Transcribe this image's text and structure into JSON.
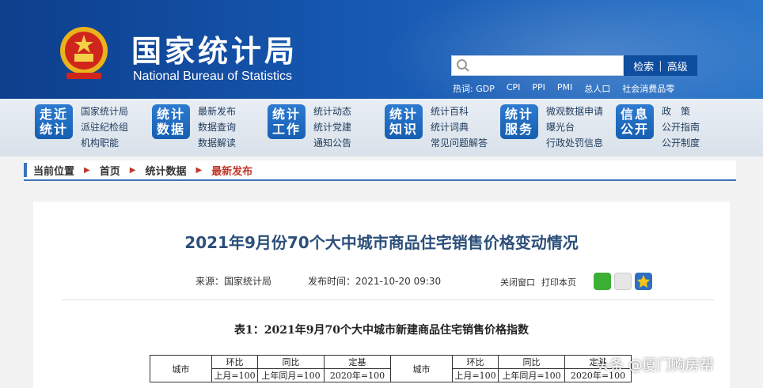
{
  "header": {
    "title": "国家统计局",
    "subtitle": "National Bureau of Statistics",
    "search_button": "检索",
    "search_separator": "|",
    "advanced_button": "高级",
    "hotwords": [
      "热词: GDP",
      "CPI",
      "PPI",
      "PMI",
      "总人口",
      "社会消费品零"
    ]
  },
  "nav": [
    {
      "badge_line1": "走近",
      "badge_line2": "统计",
      "links": [
        "国家统计局",
        "派驻纪检组",
        "机构职能"
      ]
    },
    {
      "badge_line1": "统计",
      "badge_line2": "数据",
      "links": [
        "最新发布",
        "数据查询",
        "数据解读"
      ]
    },
    {
      "badge_line1": "统计",
      "badge_line2": "工作",
      "links": [
        "统计动态",
        "统计党建",
        "通知公告"
      ]
    },
    {
      "badge_line1": "统计",
      "badge_line2": "知识",
      "links": [
        "统计百科",
        "统计词典",
        "常见问题解答"
      ]
    },
    {
      "badge_line1": "统计",
      "badge_line2": "服务",
      "links": [
        "微观数据申请",
        "曝光台",
        "行政处罚信息"
      ]
    },
    {
      "badge_line1": "信息",
      "badge_line2": "公开",
      "links": [
        "政　策",
        "公开指南",
        "公开制度"
      ]
    }
  ],
  "breadcrumb": {
    "label": "当前位置",
    "items": [
      "首页",
      "统计数据"
    ],
    "current": "最新发布",
    "arrow": "▶"
  },
  "article": {
    "title": "2021年9月份70个大中城市商品住宅销售价格变动情况",
    "source": "来源：国家统计局",
    "published": "发布时间：2021-10-20  09:30",
    "close_window": "关闭窗口",
    "print_page": "打印本页",
    "table_title": "表1：2021年9月70个大中城市新建商品住宅销售价格指数"
  },
  "table": {
    "city_header": "城市",
    "groups": [
      "环比",
      "同比",
      "定基"
    ],
    "subs": [
      "上月=100",
      "上年同月=100",
      "2020年=100"
    ]
  },
  "watermark": "头条 @厦门购房帮",
  "colors": {
    "header_blue": "#1657b0",
    "accent_red": "#c0392b",
    "title_blue": "#2c4f7a"
  }
}
